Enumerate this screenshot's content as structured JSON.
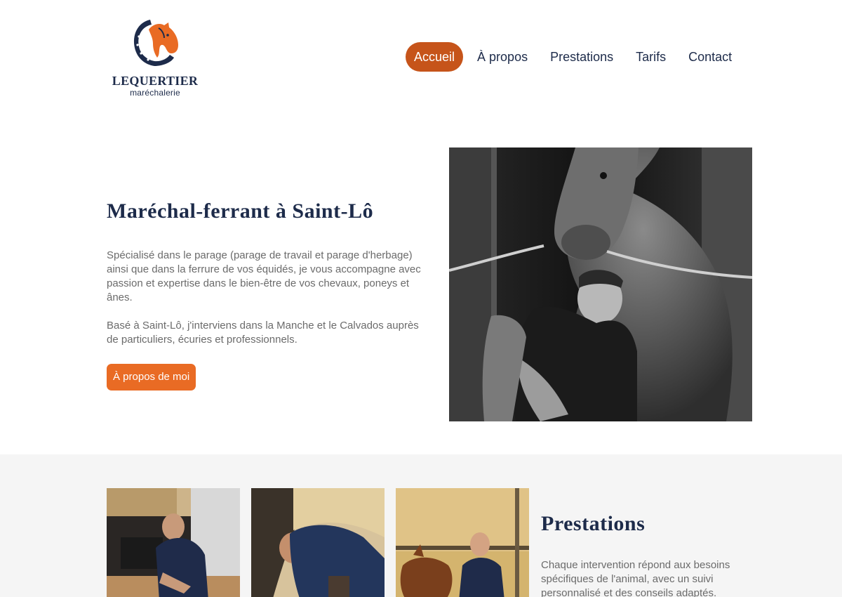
{
  "brand": {
    "name": "LEQUERTIER",
    "tagline": "maréchalerie",
    "colors": {
      "navy": "#1d2b4a",
      "orange": "#e96b24",
      "active_nav": "#c6541a"
    }
  },
  "nav": {
    "items": [
      {
        "label": "Accueil",
        "active": true
      },
      {
        "label": "À propos",
        "active": false
      },
      {
        "label": "Prestations",
        "active": false
      },
      {
        "label": "Tarifs",
        "active": false
      },
      {
        "label": "Contact",
        "active": false
      }
    ]
  },
  "hero": {
    "title": "Maréchal-ferrant à Saint-Lô",
    "paragraph1": "Spécialisé dans le parage (parage de travail et parage d'herbage) ainsi que dans la ferrure de vos équidés, je vous accompagne avec passion et expertise dans le bien-être de vos chevaux, poneys et ânes.",
    "paragraph2": "Basé à Saint-Lô, j'interviens dans la Manche et le Calvados auprès de particuliers, écuries et professionnels.",
    "button_label": "À propos de moi",
    "photo_icon": "farrier-with-horse-photo"
  },
  "services": {
    "title": "Prestations",
    "text": "Chaque intervention répond aux besoins spécifiques de l'animal, avec un suivi personnalisé et des conseils adaptés.",
    "photos": [
      "farrier-at-forge-photo",
      "farrier-trimming-hoof-photo",
      "farrier-with-chestnut-horse-photo"
    ]
  }
}
